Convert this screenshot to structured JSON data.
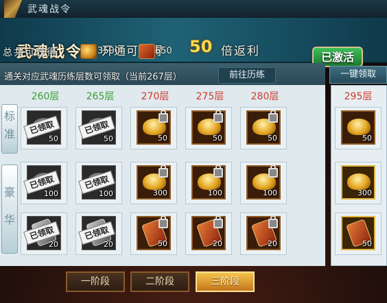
{
  "window": {
    "title": "武魂战令"
  },
  "banner": {
    "title": "武魂战令",
    "subtitle_prefix": "开通可获得",
    "multiplier": "50",
    "subtitle_suffix": "倍返利",
    "activated_label": "已激活",
    "total_label": "总共可获得",
    "resource1_value": "3500",
    "resource2_value": "650"
  },
  "info": {
    "text": "通关对应武魂历练层数可领取（当前267层）",
    "goto_label": "前往历练",
    "collect_all_label": "一键领取"
  },
  "rows": {
    "standard": "标准",
    "luxury": "豪华"
  },
  "columns": [
    {
      "floor": "260层",
      "reached": true
    },
    {
      "floor": "265层",
      "reached": true
    },
    {
      "floor": "270层",
      "reached": false
    },
    {
      "floor": "275层",
      "reached": false
    },
    {
      "floor": "280层",
      "reached": false
    }
  ],
  "right_floor": "295层",
  "claimed_label": "已领取",
  "grid": {
    "standard": [
      {
        "item": "silver",
        "qty": "50",
        "claimed": true
      },
      {
        "item": "silver",
        "qty": "50",
        "claimed": true
      },
      {
        "item": "gold",
        "qty": "50",
        "locked": true
      },
      {
        "item": "gold",
        "qty": "50",
        "locked": true
      },
      {
        "item": "gold",
        "qty": "50",
        "locked": true
      }
    ],
    "luxury1": [
      {
        "item": "silver",
        "qty": "100",
        "claimed": true
      },
      {
        "item": "silver",
        "qty": "100",
        "claimed": true
      },
      {
        "item": "gold",
        "qty": "300",
        "locked": true
      },
      {
        "item": "gold",
        "qty": "100",
        "locked": true
      },
      {
        "item": "gold",
        "qty": "100",
        "locked": true
      }
    ],
    "luxury2": [
      {
        "item": "token-gray",
        "qty": "20",
        "claimed": true
      },
      {
        "item": "token-gray",
        "qty": "20",
        "claimed": true
      },
      {
        "item": "token",
        "qty": "50",
        "locked": true
      },
      {
        "item": "token",
        "qty": "20",
        "locked": true
      },
      {
        "item": "token",
        "qty": "20",
        "locked": true
      }
    ],
    "right": [
      {
        "item": "gold",
        "qty": "50"
      },
      {
        "item": "gold",
        "qty": "300"
      },
      {
        "item": "token",
        "qty": "50"
      }
    ]
  },
  "tabs": [
    "一阶段",
    "二阶段",
    "三阶段"
  ],
  "active_tab": 2
}
